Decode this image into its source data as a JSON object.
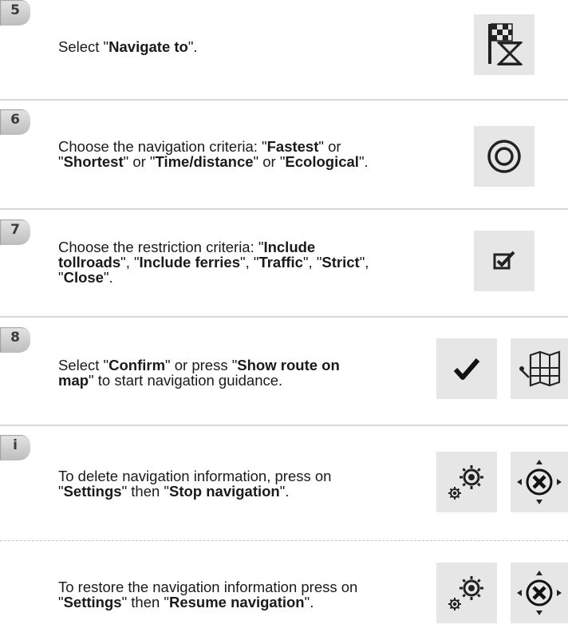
{
  "steps": [
    {
      "badge": "5",
      "parts": [
        [
          "",
          "Select \""
        ],
        [
          "b",
          "Navigate to"
        ],
        [
          "",
          "\"."
        ]
      ]
    },
    {
      "badge": "6",
      "parts": [
        [
          "",
          "Choose the navigation criteria: \""
        ],
        [
          "b",
          "Fastest"
        ],
        [
          "",
          "\" or "
        ],
        [
          "br",
          ""
        ],
        [
          "",
          "\""
        ],
        [
          "b",
          "Shortest"
        ],
        [
          "",
          "\" or \""
        ],
        [
          "b",
          "Time/distance"
        ],
        [
          "",
          "\" or \""
        ],
        [
          "b",
          "Ecological"
        ],
        [
          "",
          "\"."
        ]
      ]
    },
    {
      "badge": "7",
      "parts": [
        [
          "",
          "Choose the restriction criteria: \""
        ],
        [
          "b",
          "Include"
        ],
        [
          "br",
          ""
        ],
        [
          "b",
          "tollroads"
        ],
        [
          "",
          "\", \""
        ],
        [
          "b",
          "Include ferries"
        ],
        [
          "",
          "\", \""
        ],
        [
          "b",
          "Traffic"
        ],
        [
          "",
          "\", \""
        ],
        [
          "b",
          "Strict"
        ],
        [
          "",
          "\","
        ],
        [
          "br",
          ""
        ],
        [
          "",
          "\""
        ],
        [
          "b",
          "Close"
        ],
        [
          "",
          "\"."
        ]
      ]
    },
    {
      "badge": "8",
      "parts": [
        [
          "",
          "Select \""
        ],
        [
          "b",
          "Confirm"
        ],
        [
          "",
          "\" or press \""
        ],
        [
          "b",
          "Show route on"
        ],
        [
          "br",
          ""
        ],
        [
          "b",
          "map"
        ],
        [
          "",
          "\" to start navigation guidance."
        ]
      ]
    },
    {
      "badge": "i",
      "parts": [
        [
          "",
          "To delete navigation information, press on"
        ],
        [
          "br",
          ""
        ],
        [
          "",
          "\""
        ],
        [
          "b",
          "Settings"
        ],
        [
          "",
          "\" then \""
        ],
        [
          "b",
          "Stop navigation"
        ],
        [
          "",
          "\"."
        ]
      ]
    },
    {
      "badge": "",
      "parts": [
        [
          "",
          "To restore the navigation information press on"
        ],
        [
          "br",
          ""
        ],
        [
          "",
          "\""
        ],
        [
          "b",
          "Settings"
        ],
        [
          "",
          "\" then \""
        ],
        [
          "b",
          "Resume navigation"
        ],
        [
          "",
          "\"."
        ]
      ]
    }
  ],
  "icons": {
    "step5": [
      "flag-hourglass-icon"
    ],
    "step6": [
      "target-circle-icon"
    ],
    "step7": [
      "checkbox-icon"
    ],
    "step8": [
      "checkmark-icon",
      "route-map-icon"
    ],
    "info1": [
      "settings-gears-icon",
      "cancel-navigation-icon"
    ],
    "info2": [
      "settings-gears-icon",
      "resume-navigation-icon"
    ]
  },
  "colors": {
    "icon_bg": "#e6e6e6",
    "badge": "#c9c9c9",
    "text": "#1a1a1a",
    "divider": "#d8d8d8"
  }
}
